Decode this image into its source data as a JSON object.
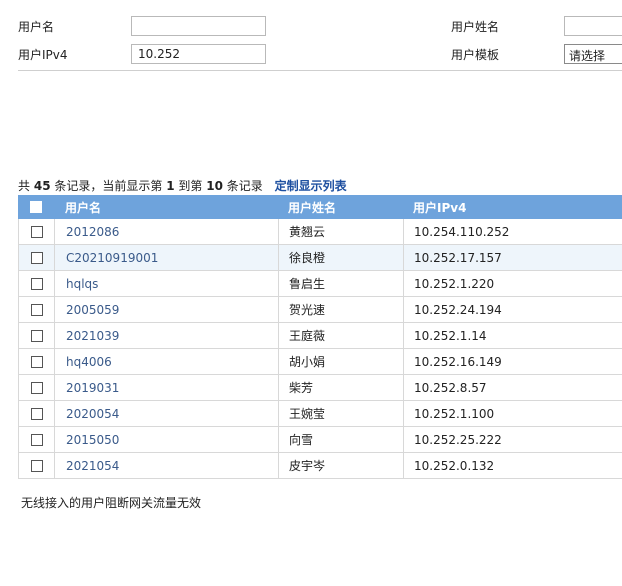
{
  "filters": {
    "username_label": "用户名",
    "username_value": "",
    "realname_label": "用户姓名",
    "realname_value": "",
    "ipv4_label": "用户IPv4",
    "ipv4_value": "10.252",
    "template_label": "用户模板",
    "template_value": "请选择"
  },
  "summary": {
    "prefix": "共",
    "total": "45",
    "mid1": "条记录，当前显示第",
    "from": "1",
    "mid2": "到第",
    "to": "10",
    "suffix": "条记录",
    "customize_link": "定制显示列表"
  },
  "table": {
    "headers": [
      "用户名",
      "用户姓名",
      "用户IPv4"
    ],
    "rows": [
      {
        "username": "2012086",
        "name": "黄翘云",
        "ipv4": "10.254.110.252"
      },
      {
        "username": "C20210919001",
        "name": "徐良橙",
        "ipv4": "10.252.17.157"
      },
      {
        "username": "hqlqs",
        "name": "鲁启生",
        "ipv4": "10.252.1.220"
      },
      {
        "username": "2005059",
        "name": "贺光速",
        "ipv4": "10.252.24.194"
      },
      {
        "username": "2021039",
        "name": "王庭薇",
        "ipv4": "10.252.1.14"
      },
      {
        "username": "hq4006",
        "name": "胡小娟",
        "ipv4": "10.252.16.149"
      },
      {
        "username": "2019031",
        "name": "柴芳",
        "ipv4": "10.252.8.57"
      },
      {
        "username": "2020054",
        "name": "王婉莹",
        "ipv4": "10.252.1.100"
      },
      {
        "username": "2015050",
        "name": "向雪",
        "ipv4": "10.252.25.222"
      },
      {
        "username": "2021054",
        "name": "皮宇岑",
        "ipv4": "10.252.0.132"
      }
    ]
  },
  "note": "无线接入的用户阻断网关流量无效",
  "colors": {
    "header_bg": "#6ea3dc",
    "link": "#1d4fa0",
    "highlight_row": "#eef5fb"
  }
}
